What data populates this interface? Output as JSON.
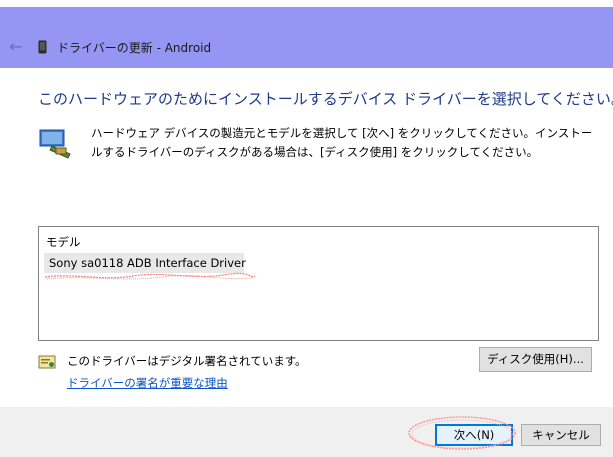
{
  "window": {
    "title": "ドライバーの更新 - Android",
    "back_icon": "arrow-left-icon",
    "device_icon": "android-device-icon",
    "title_bar_color": "#9595f3"
  },
  "main": {
    "heading": "このハードウェアのためにインストールするデバイス ドライバーを選択してください。",
    "description": "ハードウェア デバイスの製造元とモデルを選択して [次へ] をクリックしてください。インストールするドライバーのディスクがある場合は、[ディスク使用] をクリックしてください。",
    "hardware_icon": "hardware-device-icon",
    "heading_color": "#1e3a8a"
  },
  "model_list": {
    "header": "モデル",
    "items": [
      {
        "label": "Sony sa0118 ADB Interface Driver",
        "icon": "driver-icon",
        "selected": true
      }
    ]
  },
  "signature": {
    "status_text": "このドライバーはデジタル署名されています。",
    "link_text": "ドライバーの署名が重要な理由",
    "icon": "signed-driver-icon",
    "link_color": "#0a55c8"
  },
  "buttons": {
    "have_disk": "ディスク使用(H)...",
    "next": "次へ(N)",
    "cancel": "キャンセル"
  }
}
